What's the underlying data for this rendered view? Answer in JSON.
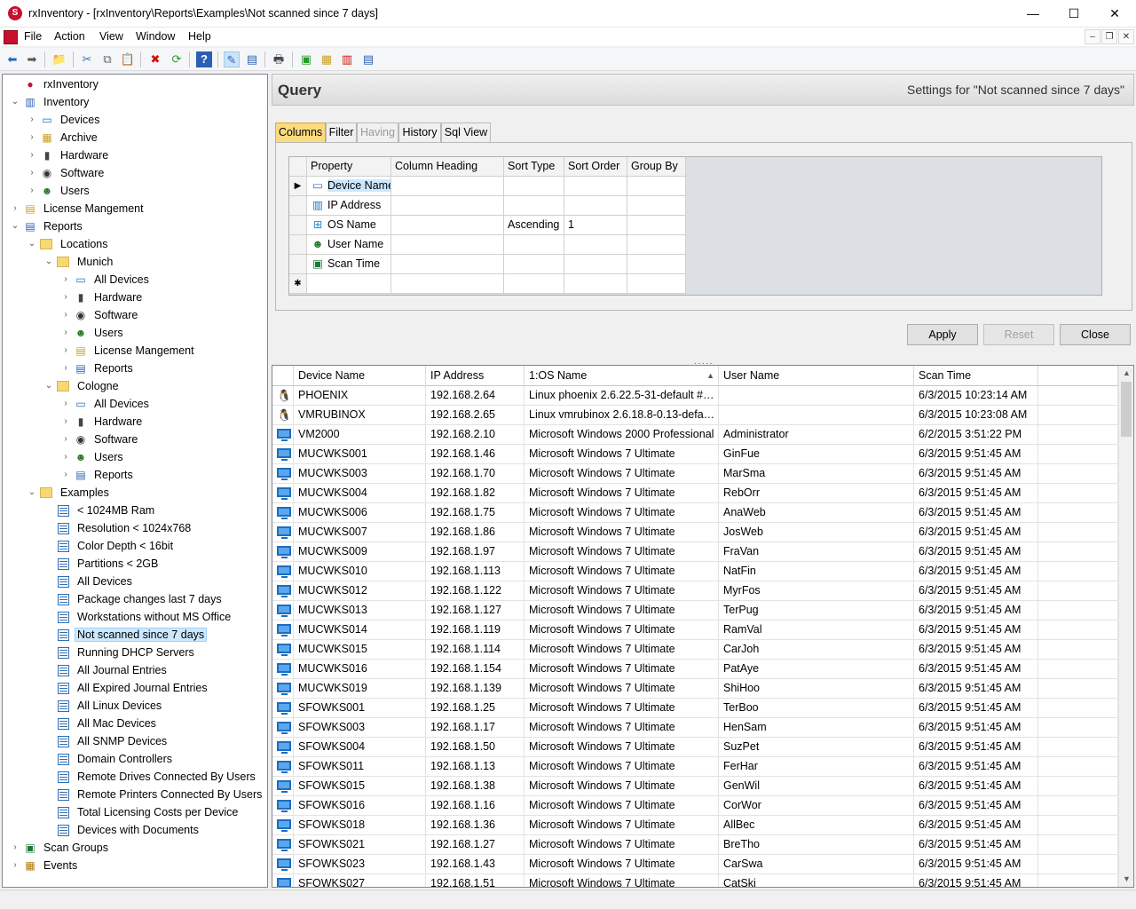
{
  "window": {
    "title": "rxInventory - [rxInventory\\Reports\\Examples\\Not scanned since 7 days]",
    "controls": {
      "minimize": "—",
      "maximize": "☐",
      "close": "✕"
    }
  },
  "menu": {
    "items": [
      "File",
      "Action",
      "View",
      "Window",
      "Help"
    ],
    "mdi": {
      "minimize": "–",
      "restore": "❐",
      "close": "✕"
    }
  },
  "tree": {
    "nodes": [
      {
        "label": "rxInventory",
        "icon": "rxinventory-icon"
      },
      {
        "label": "Inventory",
        "icon": "inventory-icon"
      },
      {
        "label": "Devices",
        "icon": "devices-icon"
      },
      {
        "label": "Archive",
        "icon": "archive-icon"
      },
      {
        "label": "Hardware",
        "icon": "hardware-icon"
      },
      {
        "label": "Software",
        "icon": "software-icon"
      },
      {
        "label": "Users",
        "icon": "users-icon"
      },
      {
        "label": "License Mangement",
        "icon": "license-icon"
      },
      {
        "label": "Reports",
        "icon": "reports-icon"
      },
      {
        "label": "Locations",
        "icon": "folder-icon"
      },
      {
        "label": "Munich",
        "icon": "folder-icon"
      },
      {
        "label": "All Devices",
        "icon": "devices-icon"
      },
      {
        "label": "Hardware",
        "icon": "hardware-icon"
      },
      {
        "label": "Software",
        "icon": "software-icon"
      },
      {
        "label": "Users",
        "icon": "users-icon"
      },
      {
        "label": "License Mangement",
        "icon": "license-icon"
      },
      {
        "label": "Reports",
        "icon": "reports-icon"
      },
      {
        "label": "Cologne",
        "icon": "folder-icon"
      },
      {
        "label": "All Devices",
        "icon": "devices-icon"
      },
      {
        "label": "Hardware",
        "icon": "hardware-icon"
      },
      {
        "label": "Software",
        "icon": "software-icon"
      },
      {
        "label": "Users",
        "icon": "users-icon"
      },
      {
        "label": "Reports",
        "icon": "reports-icon"
      },
      {
        "label": "Examples",
        "icon": "folder-icon"
      },
      {
        "label": "< 1024MB Ram",
        "icon": "report-icon"
      },
      {
        "label": "Resolution < 1024x768",
        "icon": "report-icon"
      },
      {
        "label": "Color Depth < 16bit",
        "icon": "report-icon"
      },
      {
        "label": "Partitions < 2GB",
        "icon": "report-icon"
      },
      {
        "label": "All Devices",
        "icon": "report-icon"
      },
      {
        "label": "Package changes last 7 days",
        "icon": "report-icon"
      },
      {
        "label": "Workstations without MS Office",
        "icon": "report-icon"
      },
      {
        "label": "Not scanned since 7 days",
        "icon": "report-icon",
        "selected": true
      },
      {
        "label": "Running DHCP Servers",
        "icon": "report-icon"
      },
      {
        "label": "All Journal Entries",
        "icon": "report-icon"
      },
      {
        "label": "All Expired Journal Entries",
        "icon": "report-icon"
      },
      {
        "label": "All Linux Devices",
        "icon": "report-icon"
      },
      {
        "label": "All Mac Devices",
        "icon": "report-icon"
      },
      {
        "label": "All SNMP Devices",
        "icon": "report-icon"
      },
      {
        "label": "Domain Controllers",
        "icon": "report-icon"
      },
      {
        "label": "Remote Drives Connected By Users",
        "icon": "report-icon"
      },
      {
        "label": "Remote Printers Connected By Users",
        "icon": "report-icon"
      },
      {
        "label": "Total Licensing Costs per Device",
        "icon": "report-icon"
      },
      {
        "label": "Devices with Documents",
        "icon": "report-icon"
      },
      {
        "label": "Scan Groups",
        "icon": "scan-groups-icon"
      },
      {
        "label": "Events",
        "icon": "events-icon"
      }
    ]
  },
  "query": {
    "title": "Query",
    "settings": "Settings for \"Not scanned since 7 days\"",
    "tabs": [
      {
        "label": "Columns",
        "state": "active"
      },
      {
        "label": "Filter",
        "state": "normal"
      },
      {
        "label": "Having",
        "state": "disabled"
      },
      {
        "label": "History",
        "state": "normal"
      },
      {
        "label": "Sql View",
        "state": "normal"
      }
    ],
    "grid_headers": [
      "Property",
      "Column Heading",
      "Sort Type",
      "Sort Order",
      "Group By"
    ],
    "grid_rows": [
      {
        "property": "Device Name",
        "heading": "",
        "sort_type": "",
        "sort_order": "",
        "group_by": "",
        "icon": "device-icon",
        "current": true
      },
      {
        "property": "IP Address",
        "heading": "",
        "sort_type": "",
        "sort_order": "",
        "group_by": "",
        "icon": "network-icon"
      },
      {
        "property": "OS Name",
        "heading": "",
        "sort_type": "Ascending",
        "sort_order": "1",
        "group_by": "",
        "icon": "windows-icon"
      },
      {
        "property": "User Name",
        "heading": "",
        "sort_type": "",
        "sort_order": "",
        "group_by": "",
        "icon": "user-icon"
      },
      {
        "property": "Scan Time",
        "heading": "",
        "sort_type": "",
        "sort_order": "",
        "group_by": "",
        "icon": "scan-icon"
      }
    ],
    "new_row_marker": "✱",
    "buttons": {
      "apply": "Apply",
      "reset": "Reset",
      "close": "Close"
    }
  },
  "results": {
    "headers": [
      "Device Name",
      "IP Address",
      "1:OS Name",
      "User Name",
      "Scan Time"
    ],
    "sorted_column": "1:OS Name",
    "rows": [
      [
        "PHOENIX",
        "192.168.2.64",
        "Linux phoenix 2.6.22.5-31-default #1 S...",
        "",
        "6/3/2015 10:23:14 AM",
        "linux"
      ],
      [
        "VMRUBINOX",
        "192.168.2.65",
        "Linux vmrubinox 2.6.18.8-0.13-default...",
        "",
        "6/3/2015 10:23:08 AM",
        "linux"
      ],
      [
        "VM2000",
        "192.168.2.10",
        "Microsoft Windows 2000 Professional",
        "Administrator",
        "6/2/2015 3:51:22 PM",
        "pc"
      ],
      [
        "MUCWKS001",
        "192.168.1.46",
        "Microsoft Windows 7 Ultimate",
        "GinFue",
        "6/3/2015 9:51:45 AM",
        "pc"
      ],
      [
        "MUCWKS003",
        "192.168.1.70",
        "Microsoft Windows 7 Ultimate",
        "MarSma",
        "6/3/2015 9:51:45 AM",
        "pc"
      ],
      [
        "MUCWKS004",
        "192.168.1.82",
        "Microsoft Windows 7 Ultimate",
        "RebOrr",
        "6/3/2015 9:51:45 AM",
        "pc"
      ],
      [
        "MUCWKS006",
        "192.168.1.75",
        "Microsoft Windows 7 Ultimate",
        "AnaWeb",
        "6/3/2015 9:51:45 AM",
        "pc"
      ],
      [
        "MUCWKS007",
        "192.168.1.86",
        "Microsoft Windows 7 Ultimate",
        "JosWeb",
        "6/3/2015 9:51:45 AM",
        "pc"
      ],
      [
        "MUCWKS009",
        "192.168.1.97",
        "Microsoft Windows 7 Ultimate",
        "FraVan",
        "6/3/2015 9:51:45 AM",
        "pc"
      ],
      [
        "MUCWKS010",
        "192.168.1.113",
        "Microsoft Windows 7 Ultimate",
        "NatFin",
        "6/3/2015 9:51:45 AM",
        "pc"
      ],
      [
        "MUCWKS012",
        "192.168.1.122",
        "Microsoft Windows 7 Ultimate",
        "MyrFos",
        "6/3/2015 9:51:45 AM",
        "pc"
      ],
      [
        "MUCWKS013",
        "192.168.1.127",
        "Microsoft Windows 7 Ultimate",
        "TerPug",
        "6/3/2015 9:51:45 AM",
        "pc"
      ],
      [
        "MUCWKS014",
        "192.168.1.119",
        "Microsoft Windows 7 Ultimate",
        "RamVal",
        "6/3/2015 9:51:45 AM",
        "pc"
      ],
      [
        "MUCWKS015",
        "192.168.1.114",
        "Microsoft Windows 7 Ultimate",
        "CarJoh",
        "6/3/2015 9:51:45 AM",
        "pc"
      ],
      [
        "MUCWKS016",
        "192.168.1.154",
        "Microsoft Windows 7 Ultimate",
        "PatAye",
        "6/3/2015 9:51:45 AM",
        "pc"
      ],
      [
        "MUCWKS019",
        "192.168.1.139",
        "Microsoft Windows 7 Ultimate",
        "ShiHoo",
        "6/3/2015 9:51:45 AM",
        "pc"
      ],
      [
        "SFOWKS001",
        "192.168.1.25",
        "Microsoft Windows 7 Ultimate",
        "TerBoo",
        "6/3/2015 9:51:45 AM",
        "pc"
      ],
      [
        "SFOWKS003",
        "192.168.1.17",
        "Microsoft Windows 7 Ultimate",
        "HenSam",
        "6/3/2015 9:51:45 AM",
        "pc"
      ],
      [
        "SFOWKS004",
        "192.168.1.50",
        "Microsoft Windows 7 Ultimate",
        "SuzPet",
        "6/3/2015 9:51:45 AM",
        "pc"
      ],
      [
        "SFOWKS011",
        "192.168.1.13",
        "Microsoft Windows 7 Ultimate",
        "FerHar",
        "6/3/2015 9:51:45 AM",
        "pc"
      ],
      [
        "SFOWKS015",
        "192.168.1.38",
        "Microsoft Windows 7 Ultimate",
        "GenWil",
        "6/3/2015 9:51:45 AM",
        "pc"
      ],
      [
        "SFOWKS016",
        "192.168.1.16",
        "Microsoft Windows 7 Ultimate",
        "CorWor",
        "6/3/2015 9:51:45 AM",
        "pc"
      ],
      [
        "SFOWKS018",
        "192.168.1.36",
        "Microsoft Windows 7 Ultimate",
        "AllBec",
        "6/3/2015 9:51:45 AM",
        "pc"
      ],
      [
        "SFOWKS021",
        "192.168.1.27",
        "Microsoft Windows 7 Ultimate",
        "BreTho",
        "6/3/2015 9:51:45 AM",
        "pc"
      ],
      [
        "SFOWKS023",
        "192.168.1.43",
        "Microsoft Windows 7 Ultimate",
        "CarSwa",
        "6/3/2015 9:51:45 AM",
        "pc"
      ],
      [
        "SFOWKS027",
        "192.168.1.51",
        "Microsoft Windows 7 Ultimate",
        "CatSki",
        "6/3/2015 9:51:45 AM",
        "pc"
      ]
    ]
  },
  "colors": {
    "accent_tab": "#fadb7e",
    "selection": "#cce8ff",
    "brand": "#c8102e"
  }
}
